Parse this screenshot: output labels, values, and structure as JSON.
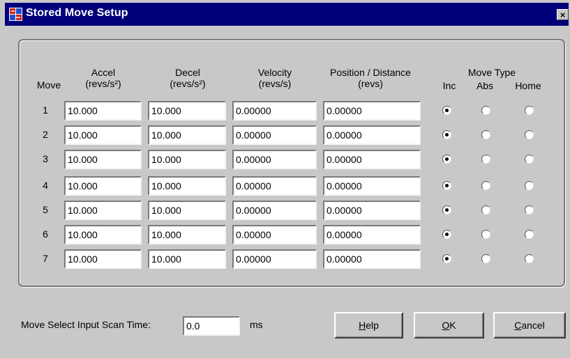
{
  "window": {
    "title": "Stored Move Setup",
    "close_label": "×"
  },
  "headers": {
    "move": "Move",
    "accel": "Accel",
    "accel_unit": "(revs/s²)",
    "decel": "Decel",
    "decel_unit": "(revs/s²)",
    "velocity": "Velocity",
    "velocity_unit": "(revs/s)",
    "position": "Position / Distance",
    "position_unit": "(revs)",
    "move_type": "Move Type",
    "inc": "Inc",
    "abs": "Abs",
    "home": "Home"
  },
  "moves": [
    {
      "num": "1",
      "accel": "10.000",
      "decel": "10.000",
      "velocity": "0.00000",
      "position": "0.00000",
      "type": "inc"
    },
    {
      "num": "2",
      "accel": "10.000",
      "decel": "10.000",
      "velocity": "0.00000",
      "position": "0.00000",
      "type": "inc"
    },
    {
      "num": "3",
      "accel": "10.000",
      "decel": "10.000",
      "velocity": "0.00000",
      "position": "0.00000",
      "type": "inc"
    },
    {
      "num": "4",
      "accel": "10.000",
      "decel": "10.000",
      "velocity": "0.00000",
      "position": "0.00000",
      "type": "inc"
    },
    {
      "num": "5",
      "accel": "10.000",
      "decel": "10.000",
      "velocity": "0.00000",
      "position": "0.00000",
      "type": "inc"
    },
    {
      "num": "6",
      "accel": "10.000",
      "decel": "10.000",
      "velocity": "0.00000",
      "position": "0.00000",
      "type": "inc"
    },
    {
      "num": "7",
      "accel": "10.000",
      "decel": "10.000",
      "velocity": "0.00000",
      "position": "0.00000",
      "type": "inc"
    }
  ],
  "scan_time": {
    "label": "Move Select Input Scan Time:",
    "value": "0.0",
    "unit": "ms"
  },
  "buttons": {
    "help": {
      "mnemonic": "H",
      "rest": "elp"
    },
    "ok": {
      "mnemonic": "O",
      "rest": "K"
    },
    "cancel": {
      "mnemonic": "C",
      "rest": "ancel"
    }
  },
  "colors": {
    "titlebar": "#00007b",
    "face": "#c8c8c8"
  }
}
